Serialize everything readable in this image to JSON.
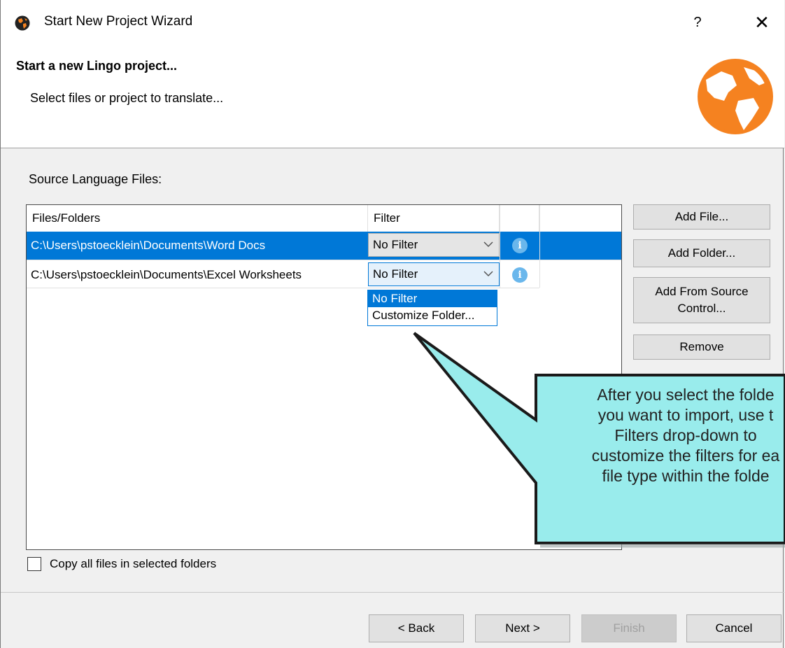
{
  "window": {
    "title": "Start New Project Wizard",
    "help_glyph": "?",
    "close_glyph": "✕"
  },
  "header": {
    "title": "Start a new Lingo project...",
    "subtitle": "Select files or project to translate..."
  },
  "source_label": "Source Language Files:",
  "table": {
    "columns": [
      "Files/Folders",
      "Filter"
    ],
    "rows": [
      {
        "path": "C:\\Users\\pstoecklein\\Documents\\Word Docs",
        "filter": "No Filter"
      },
      {
        "path": "C:\\Users\\pstoecklein\\Documents\\Excel Worksheets",
        "filter": "No Filter"
      }
    ]
  },
  "filter_dropdown": {
    "options": [
      "No Filter",
      "Customize Folder..."
    ]
  },
  "side_buttons": {
    "add_file": "Add File...",
    "add_folder": "Add Folder...",
    "add_source_line1": "Add From Source",
    "add_source_line2": "Control...",
    "remove": "Remove"
  },
  "copy_checkbox": {
    "label": "Copy all files in selected folders",
    "checked": false
  },
  "footer_buttons": {
    "back": "< Back",
    "next": "Next >",
    "finish": "Finish",
    "cancel": "Cancel"
  },
  "callout": {
    "lines": [
      "After you select the folde",
      "you want to import, use t",
      "Filters drop-down to",
      "customize the filters for ea",
      "file type within the folde"
    ]
  },
  "colors": {
    "selection": "#0078d7",
    "callout_fill": "#99ecec",
    "globe": "#f58220"
  },
  "icons": {
    "app": "globe-app-icon",
    "info": "info-icon",
    "globe": "globe-logo"
  }
}
